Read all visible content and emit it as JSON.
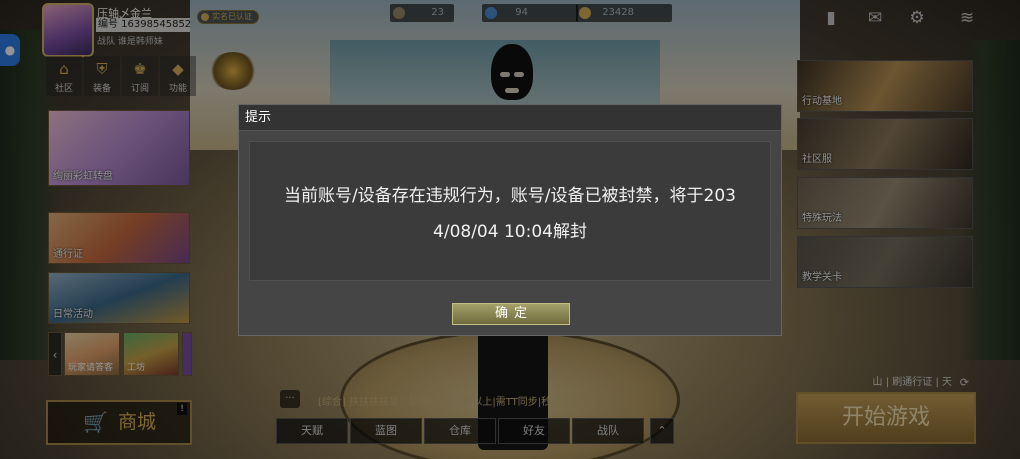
{
  "profile": {
    "name": "压轴乄金兰",
    "account_id": "编号 163985458529",
    "team": "战队 谁是韩师妹",
    "verified_badge": "实名已认证"
  },
  "resources": [
    {
      "icon": "ticket-icon",
      "value": "23",
      "color": "#9a8a6a"
    },
    {
      "icon": "gem-icon",
      "value": "94",
      "color": "#4f8fd6"
    },
    {
      "icon": "coin-icon",
      "value": "23428",
      "color": "#d9b15a"
    }
  ],
  "top_right_icons": [
    "bookmark-icon",
    "mail-icon",
    "gear-icon",
    "wifi-battery-icon"
  ],
  "left_icons": [
    {
      "icon": "home-icon",
      "label": "社区"
    },
    {
      "icon": "shield-icon",
      "label": "装备"
    },
    {
      "icon": "crown-icon",
      "label": "订阅"
    },
    {
      "icon": "function-icon",
      "label": "功能"
    }
  ],
  "left_tiles": {
    "rainbow": "绚丽彩虹转盘",
    "pass": "通行证",
    "daily": "日常活动",
    "small_1": "玩家请答客",
    "small_2": "工坊",
    "small_3": "商"
  },
  "shop": {
    "label": "商城",
    "badge": "!"
  },
  "right_tiles": [
    "行动基地",
    "社区服",
    "特殊玩法",
    "教学关卡"
  ],
  "pass_strip": "山 | 刷通行证 | 天",
  "start_button": "开始游戏",
  "chat": {
    "icon_label": "···",
    "line": "[综合] 扶扶扶扶哥：联盟招人|王牌以上|需TT同步|秒改|6+|"
  },
  "bottom_nav": [
    "天赋",
    "蓝图",
    "仓库",
    "好友",
    "战队"
  ],
  "bottom_nav_toggle": "⌃",
  "dialog": {
    "title": "提示",
    "message_line1": "当前账号/设备存在违规行为，账号/设备已被封禁，将于203",
    "message_line2": "4/08/04 10:04解封",
    "ok_label": "确定"
  }
}
